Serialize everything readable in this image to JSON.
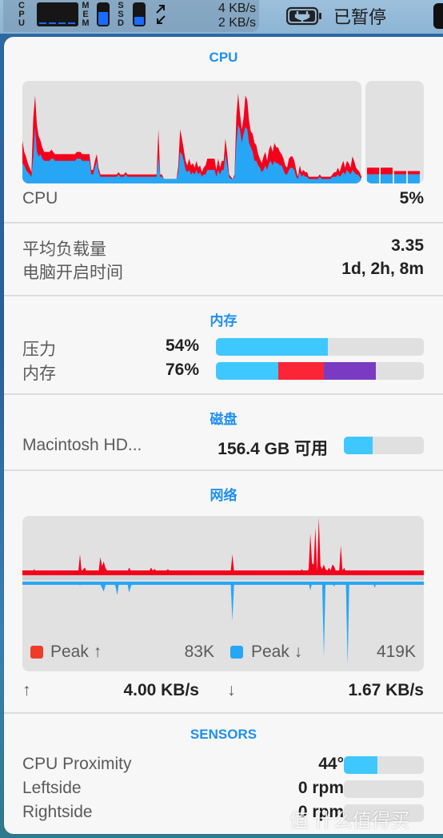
{
  "menubar": {
    "cpu_label": [
      "C",
      "P",
      "U"
    ],
    "mem_label": [
      "M",
      "E",
      "M"
    ],
    "ssd_label": [
      "S",
      "S",
      "D"
    ],
    "mem_fill": 0.62,
    "ssd_fill": 0.38,
    "net_up": "4 KB/s",
    "net_down": "2 KB/s",
    "battery_status": "已暂停",
    "icons": {
      "arrows": "↗↙",
      "battery": "battery-plug-icon"
    }
  },
  "cpu": {
    "title": "CPU",
    "label": "CPU",
    "value": "5%",
    "history_system": [
      9,
      8,
      6,
      5,
      4,
      3,
      12,
      25,
      14,
      12,
      13,
      11,
      10,
      10,
      10,
      10,
      11,
      11,
      10,
      10,
      10,
      10,
      10,
      10,
      10,
      10,
      10,
      10,
      10,
      10,
      11,
      11,
      11,
      10,
      10,
      10,
      10,
      10,
      4,
      4,
      7,
      10,
      5,
      3,
      3,
      3,
      3,
      3,
      3,
      3,
      3,
      3,
      3,
      4,
      3,
      3,
      3,
      4,
      3,
      3,
      3,
      3,
      3,
      3,
      3,
      3,
      3,
      3,
      3,
      3,
      3,
      3,
      3,
      3,
      3,
      12,
      3,
      3,
      2,
      2,
      2,
      2,
      2,
      2,
      2,
      2,
      5,
      14,
      13,
      10,
      6,
      5,
      6,
      4,
      5,
      4,
      6,
      4,
      5,
      3,
      4,
      4,
      6,
      6,
      6,
      6,
      6,
      3,
      6,
      4,
      6,
      6,
      13,
      8,
      3,
      2,
      2,
      3,
      18,
      26,
      24,
      18,
      22,
      25,
      24,
      18,
      16,
      14,
      10,
      10,
      8,
      7,
      5,
      6,
      8,
      6,
      9,
      10,
      8,
      10,
      9,
      9,
      8,
      8,
      6,
      4,
      4,
      6,
      7,
      7,
      6,
      3,
      2,
      5,
      3,
      4,
      3,
      3,
      2,
      2,
      2,
      2,
      2,
      2,
      3,
      2,
      2,
      2,
      2,
      2,
      2,
      3,
      3,
      3,
      4,
      3,
      4,
      5,
      4,
      6,
      5,
      4,
      6,
      5,
      4,
      4,
      3,
      2
    ],
    "history_user": [
      10,
      6,
      6,
      4,
      3,
      2,
      17,
      14,
      12,
      9,
      6,
      5,
      4,
      4,
      4,
      4,
      4,
      3,
      3,
      3,
      3,
      3,
      3,
      3,
      3,
      3,
      3,
      3,
      3,
      3,
      3,
      3,
      3,
      3,
      3,
      3,
      3,
      3,
      2,
      2,
      3,
      3,
      2,
      1,
      1,
      1,
      1,
      1,
      1,
      1,
      1,
      1,
      1,
      1,
      1,
      1,
      1,
      1,
      1,
      1,
      1,
      1,
      1,
      1,
      1,
      1,
      1,
      1,
      1,
      1,
      1,
      1,
      1,
      1,
      1,
      12,
      1,
      1,
      0,
      0,
      0,
      0,
      0,
      0,
      0,
      0,
      3,
      10,
      7,
      5,
      4,
      3,
      5,
      4,
      4,
      3,
      4,
      3,
      3,
      2,
      3,
      4,
      5,
      5,
      5,
      5,
      5,
      3,
      5,
      3,
      4,
      4,
      7,
      5,
      1,
      1,
      0,
      1,
      12,
      14,
      7,
      6,
      7,
      14,
      13,
      10,
      7,
      8,
      8,
      7,
      5,
      4,
      4,
      6,
      6,
      4,
      6,
      7,
      6,
      8,
      7,
      7,
      6,
      5,
      5,
      4,
      3,
      5,
      5,
      5,
      4,
      3,
      1,
      3,
      2,
      2,
      2,
      2,
      1,
      1,
      1,
      1,
      1,
      1,
      1,
      1,
      1,
      1,
      1,
      1,
      1,
      1,
      2,
      2,
      3,
      2,
      4,
      5,
      3,
      4,
      4,
      3,
      6,
      5,
      3,
      2,
      2,
      1
    ],
    "cores": [
      {
        "system": 4,
        "user": 3
      },
      {
        "system": 4,
        "user": 3
      },
      {
        "system": 4,
        "user": 1.5
      },
      {
        "system": 4,
        "user": 1.5
      }
    ],
    "colors": {
      "system": "#27a6f5",
      "user": "#f4001c"
    }
  },
  "load": {
    "rows": [
      {
        "label": "平均负载量",
        "value": "3.35"
      },
      {
        "label": "电脑开启时间",
        "value": "1d, 2h, 8m"
      }
    ]
  },
  "memory": {
    "title": "内存",
    "rows": [
      {
        "label": "压力",
        "value": "54%",
        "segments": [
          {
            "fraction": 0.54,
            "color": "#3ec8ff"
          }
        ]
      },
      {
        "label": "内存",
        "value": "76%",
        "segments": [
          {
            "fraction": 0.3,
            "color": "#3ec8ff"
          },
          {
            "fraction": 0.22,
            "color": "#fc2536"
          },
          {
            "fraction": 0.25,
            "color": "#7a3ac2"
          }
        ]
      }
    ]
  },
  "disk": {
    "title": "磁盘",
    "name": "Macintosh HD...",
    "free": "156.4 GB 可用",
    "used_fraction": 0.36,
    "color": "#3ec8ff"
  },
  "network": {
    "title": "网络",
    "upload_history": [
      0,
      0,
      0,
      0,
      0,
      0,
      0,
      2,
      0,
      0,
      0,
      0,
      0,
      0,
      0,
      0,
      1,
      0,
      0,
      0,
      0,
      0,
      0,
      1,
      0,
      0,
      0,
      0,
      0,
      0,
      0,
      0,
      0,
      0,
      12,
      0,
      2,
      3,
      0,
      0,
      0,
      0,
      0,
      0,
      0,
      0,
      10,
      4,
      7,
      3,
      1,
      0,
      1,
      1,
      1,
      0,
      0,
      0,
      0,
      0,
      0,
      0,
      0,
      3,
      1,
      0,
      0,
      0,
      0,
      0,
      0,
      0,
      0,
      0,
      1,
      1,
      3,
      1,
      2,
      1,
      1,
      0,
      1,
      1,
      0,
      1,
      2,
      0,
      0,
      1,
      0,
      0,
      0,
      0,
      0,
      0,
      0,
      0,
      0,
      0,
      0,
      0,
      0,
      0,
      0,
      0,
      0,
      0,
      0,
      0,
      0,
      0,
      0,
      1,
      0,
      0,
      0,
      0,
      0,
      0,
      0,
      0,
      0,
      0,
      12,
      0,
      0,
      0,
      0,
      0,
      0,
      0,
      0,
      0,
      0,
      0,
      0,
      0,
      0,
      0,
      0,
      0,
      0,
      0,
      0,
      0,
      0,
      0,
      0,
      0,
      0,
      0,
      0,
      1,
      0,
      0,
      0,
      0,
      0,
      0,
      0,
      0,
      0,
      0,
      0,
      2,
      0,
      0,
      0,
      2,
      26,
      6,
      5,
      30,
      0,
      37,
      4,
      2,
      5,
      2,
      1,
      3,
      1,
      5,
      4,
      1,
      0,
      0,
      18,
      1,
      3,
      0,
      0,
      0,
      0,
      0,
      1,
      0,
      0,
      0,
      0,
      0,
      1,
      1,
      0,
      0,
      0,
      0,
      0,
      0,
      0,
      0,
      0,
      0,
      0,
      0,
      0,
      0,
      0,
      0,
      0,
      0,
      0,
      0,
      0,
      0,
      0,
      0,
      0,
      0,
      0,
      0,
      0,
      0,
      0,
      0,
      0,
      0
    ],
    "download_history": [
      0,
      0,
      0,
      0,
      0,
      0,
      0,
      0,
      0,
      0,
      0,
      0,
      0,
      0,
      0,
      0,
      0,
      0,
      0,
      0,
      0,
      0,
      0,
      0,
      0,
      0,
      0,
      0,
      0,
      0,
      0,
      0,
      0,
      0,
      2,
      0,
      0,
      0,
      0,
      0,
      0,
      0,
      0,
      0,
      0,
      0,
      1,
      4,
      7,
      2,
      0,
      0,
      0,
      0,
      0,
      3,
      10,
      1,
      0,
      0,
      0,
      0,
      0,
      8,
      3,
      0,
      0,
      0,
      0,
      0,
      0,
      0,
      0,
      0,
      0,
      0,
      0,
      0,
      0,
      0,
      0,
      0,
      0,
      0,
      0,
      0,
      0,
      0,
      0,
      0,
      0,
      0,
      0,
      0,
      0,
      0,
      0,
      0,
      0,
      0,
      0,
      0,
      0,
      0,
      0,
      0,
      0,
      0,
      0,
      0,
      0,
      0,
      0,
      0,
      0,
      0,
      0,
      0,
      0,
      0,
      0,
      0,
      0,
      0,
      32,
      0,
      0,
      0,
      0,
      0,
      0,
      0,
      0,
      0,
      0,
      0,
      0,
      0,
      0,
      0,
      0,
      0,
      0,
      0,
      0,
      0,
      0,
      0,
      0,
      0,
      0,
      0,
      0,
      0,
      0,
      0,
      0,
      0,
      0,
      0,
      0,
      0,
      0,
      0,
      0,
      0,
      0,
      0,
      0,
      0,
      6,
      0,
      0,
      0,
      0,
      0,
      0,
      0,
      62,
      0,
      0,
      0,
      0,
      0,
      3,
      0,
      0,
      0,
      0,
      0,
      0,
      0,
      69,
      0,
      0,
      0,
      0,
      0,
      0,
      0,
      0,
      0,
      0,
      0,
      0,
      0,
      0,
      0,
      4,
      0,
      0,
      0,
      0,
      0,
      0,
      0,
      0,
      0,
      0,
      0,
      0,
      0,
      0,
      0,
      0,
      0,
      0,
      0,
      0,
      0,
      0,
      0,
      0,
      0,
      0,
      0,
      0,
      0,
      0,
      0,
      0,
      0,
      0,
      0,
      0,
      0
    ],
    "legend": [
      {
        "label": "Peak ↑",
        "value": "83K",
        "color": "#f03b2a"
      },
      {
        "label": "Peak ↓",
        "value": "419K",
        "color": "#27a6f5"
      }
    ],
    "upload_arrow": "↑",
    "upload_rate": "4.00 KB/s",
    "download_arrow": "↓",
    "download_rate": "1.67 KB/s",
    "colors": {
      "upload": "#f4001c",
      "download": "#27a6f5"
    }
  },
  "sensors": {
    "title": "SENSORS",
    "rows": [
      {
        "label": "CPU Proximity",
        "value": "44°",
        "fraction": 0.42
      },
      {
        "label": "Leftside",
        "value": "0 rpm",
        "fraction": 0
      },
      {
        "label": "Rightside",
        "value": "0 rpm",
        "fraction": 0
      }
    ],
    "color": "#3ec8ff"
  },
  "watermark": "值 什么值得买"
}
